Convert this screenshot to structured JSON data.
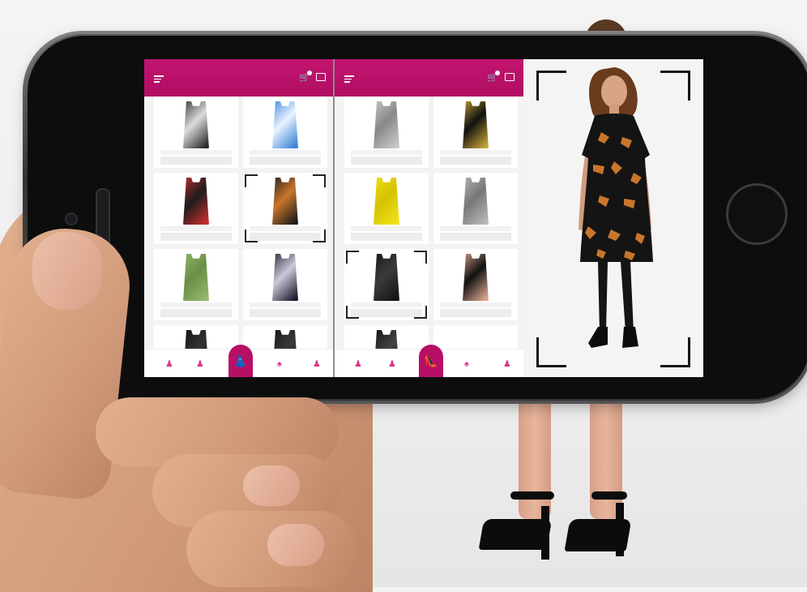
{
  "app": {
    "brand_color": "#b70f66",
    "background_color": "#f3f3f3"
  },
  "panels": [
    {
      "name": "tops-catalog",
      "active_tab_icon": "dress-icon",
      "items": [
        {
          "icon": "camisole-icon",
          "colors": [
            "#2a2a2a",
            "#dcdcdc"
          ]
        },
        {
          "icon": "blue-floral-top-icon",
          "colors": [
            "#3a84d8",
            "#e9f3ff"
          ]
        },
        {
          "icon": "red-floral-top-icon",
          "colors": [
            "#c72d2d",
            "#1d1d1d"
          ]
        },
        {
          "icon": "printed-tunic-icon",
          "colors": [
            "#1a1a1a",
            "#c9762c"
          ],
          "selected": true
        },
        {
          "icon": "green-tank-icon",
          "colors": [
            "#95b86c",
            "#6b8e47"
          ]
        },
        {
          "icon": "halter-top-icon",
          "colors": [
            "#1b1b2f",
            "#c9c9d9"
          ]
        },
        {
          "icon": "black-jacket-icon",
          "colors": [
            "#101010",
            "#333333"
          ]
        },
        {
          "icon": "black-bustier-icon",
          "colors": [
            "#121212",
            "#3a3a3a"
          ]
        }
      ]
    },
    {
      "name": "shoes-catalog",
      "active_tab_icon": "shoe-icon",
      "items": [
        {
          "icon": "strappy-sandal-silver-icon",
          "colors": [
            "#c9c9c9",
            "#888888"
          ]
        },
        {
          "icon": "gold-caged-heel-icon",
          "colors": [
            "#c7a437",
            "#111111"
          ]
        },
        {
          "icon": "yellow-pump-icon",
          "colors": [
            "#f1e21c",
            "#d5c200"
          ]
        },
        {
          "icon": "silver-sandal-icon",
          "colors": [
            "#b9b9b9",
            "#777777"
          ]
        },
        {
          "icon": "black-ankle-boot-icon",
          "colors": [
            "#141414",
            "#3b3b3b"
          ],
          "selected": true
        },
        {
          "icon": "nude-black-heel-icon",
          "colors": [
            "#d9a58f",
            "#111111"
          ]
        },
        {
          "icon": "black-heel-icon",
          "colors": [
            "#0f0f0f",
            "#444444"
          ]
        },
        {
          "icon": "empty-slot-icon",
          "colors": [
            "#ffffff",
            "#ffffff"
          ]
        }
      ]
    }
  ],
  "bottom_tabs": [
    "tank-icon",
    "jacket-icon",
    "active-category-icon",
    "skirt-icon",
    "dress-small-icon"
  ],
  "model": {
    "outfit": "printed-tunic-icon",
    "dress_colors": [
      "#141414",
      "#c9762c"
    ]
  }
}
